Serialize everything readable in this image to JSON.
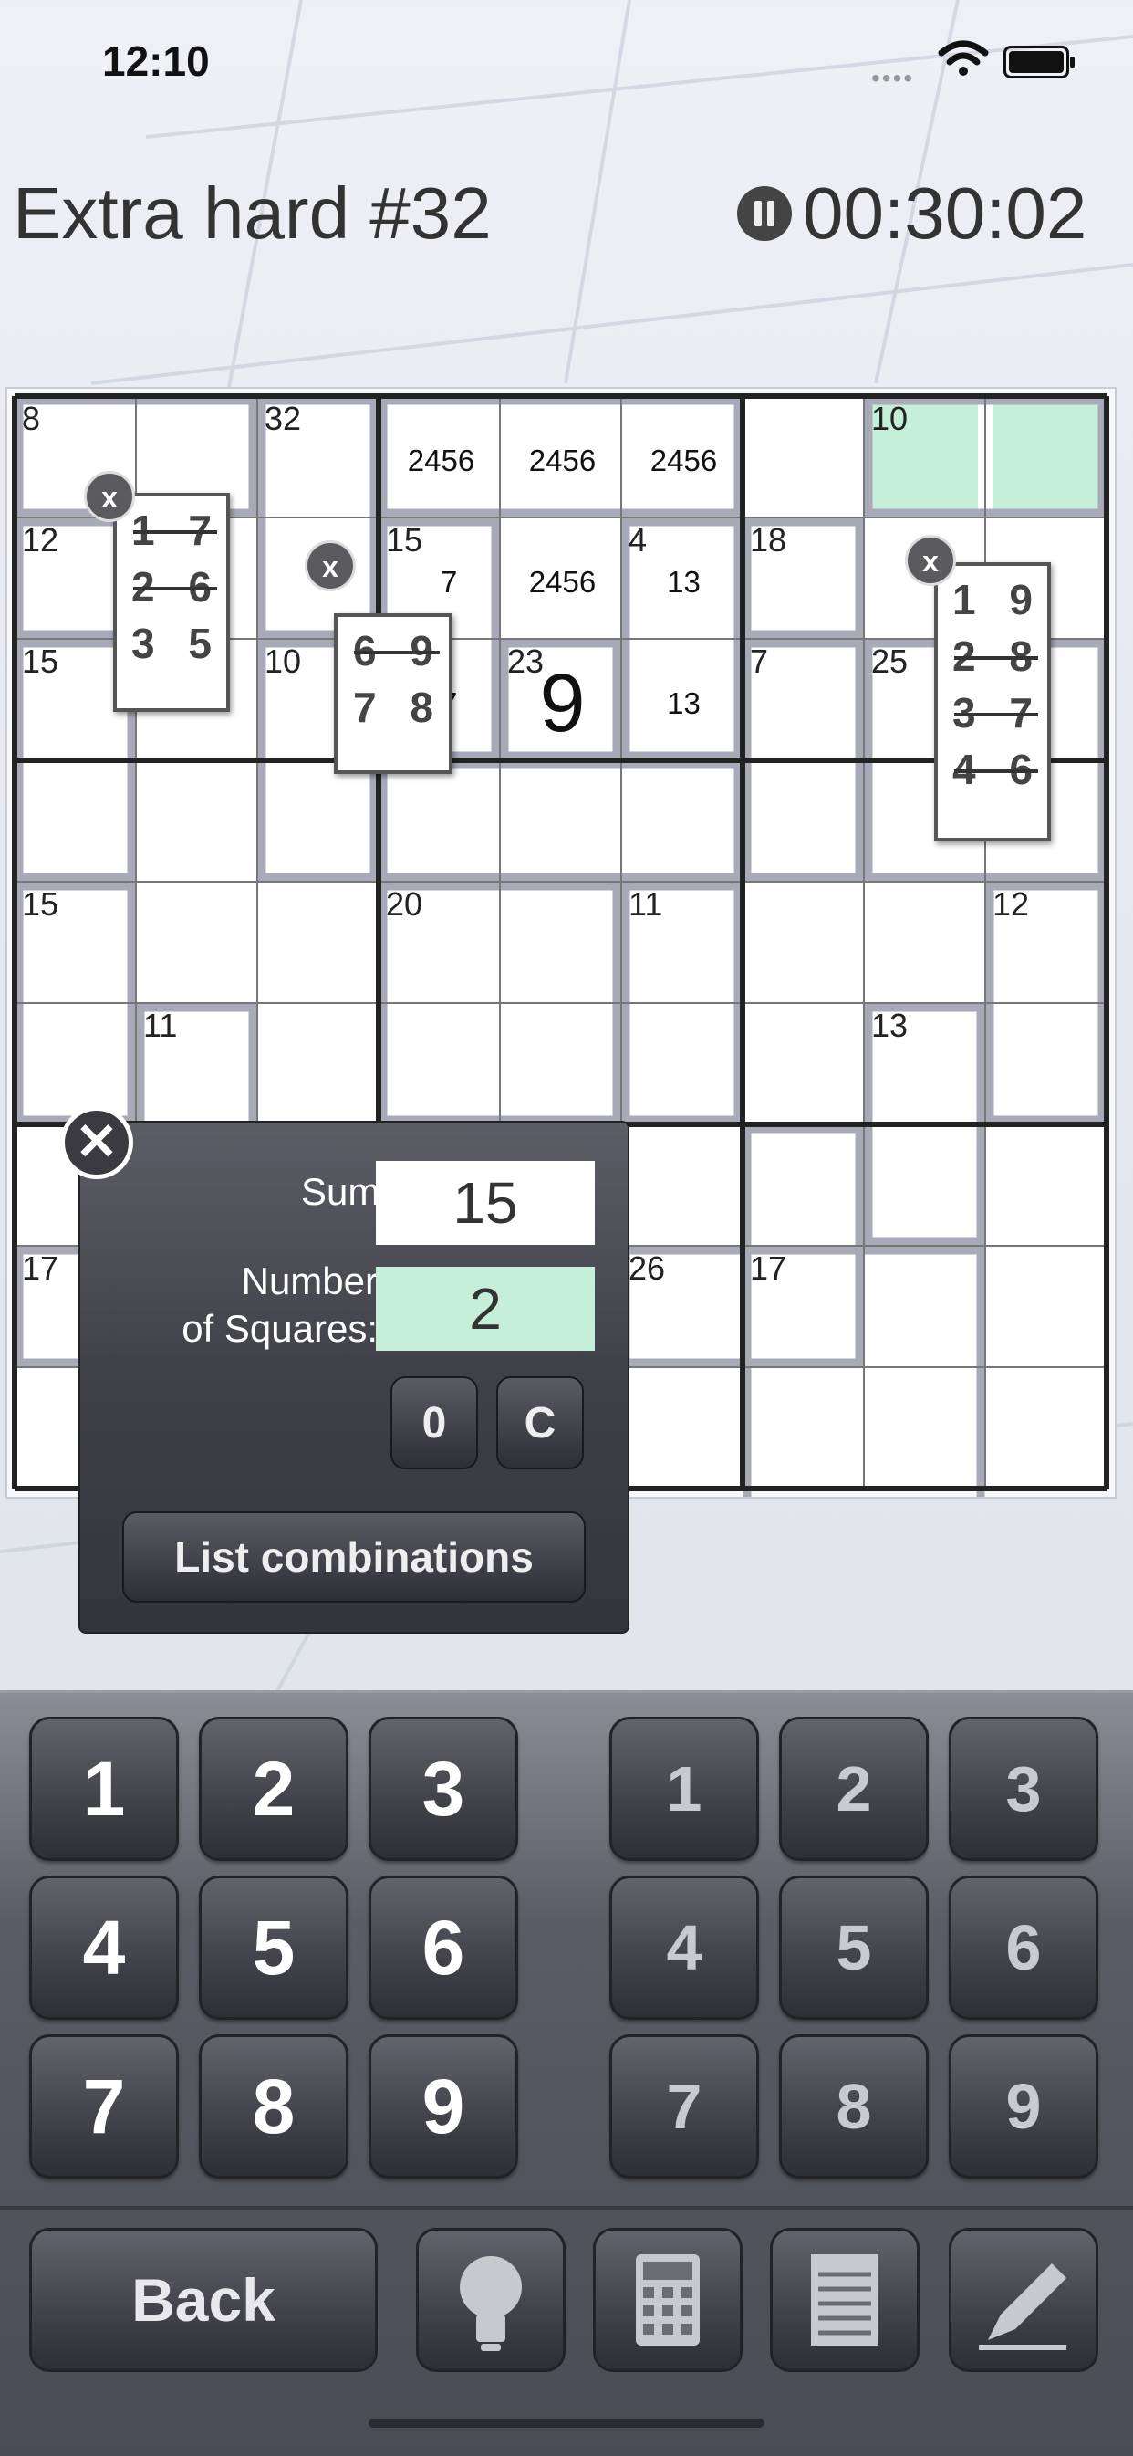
{
  "status": {
    "time": "12:10"
  },
  "header": {
    "title": "Extra hard #32",
    "timer": "00:30:02"
  },
  "board": {
    "cage_sums": [
      {
        "label": "8",
        "cell": [
          0,
          0
        ]
      },
      {
        "label": "32",
        "cell": [
          0,
          2
        ]
      },
      {
        "label": "10",
        "cell": [
          0,
          7
        ]
      },
      {
        "label": "12",
        "cell": [
          1,
          0
        ]
      },
      {
        "label": "15",
        "cell": [
          1,
          3
        ]
      },
      {
        "label": "4",
        "cell": [
          1,
          5
        ]
      },
      {
        "label": "18",
        "cell": [
          1,
          6
        ]
      },
      {
        "label": "15",
        "cell": [
          2,
          0
        ]
      },
      {
        "label": "10",
        "cell": [
          2,
          2
        ]
      },
      {
        "label": "23",
        "cell": [
          2,
          4
        ]
      },
      {
        "label": "7",
        "cell": [
          2,
          6
        ]
      },
      {
        "label": "25",
        "cell": [
          2,
          7
        ]
      },
      {
        "label": "15",
        "cell": [
          4,
          0
        ]
      },
      {
        "label": "20",
        "cell": [
          4,
          3
        ]
      },
      {
        "label": "11",
        "cell": [
          4,
          5
        ]
      },
      {
        "label": "12",
        "cell": [
          4,
          8
        ]
      },
      {
        "label": "11",
        "cell": [
          5,
          1
        ]
      },
      {
        "label": "13",
        "cell": [
          5,
          7
        ]
      },
      {
        "label": "17",
        "cell": [
          7,
          0
        ]
      },
      {
        "label": "26",
        "cell": [
          7,
          5
        ]
      },
      {
        "label": "17",
        "cell": [
          7,
          6
        ]
      }
    ],
    "candidates": [
      {
        "text": "2456",
        "cell": [
          0,
          3
        ]
      },
      {
        "text": "2456",
        "cell": [
          0,
          4
        ]
      },
      {
        "text": "2456",
        "cell": [
          0,
          5
        ]
      },
      {
        "text": "2456",
        "cell": [
          1,
          4
        ]
      },
      {
        "text": "13",
        "cell": [
          1,
          5
        ]
      },
      {
        "text": "13",
        "cell": [
          2,
          5
        ]
      }
    ],
    "values": [
      {
        "text": "9",
        "cell": [
          2,
          4
        ]
      }
    ],
    "highlight_color": "#c6efd9",
    "combo_popups": [
      {
        "rows": [
          {
            "t": "1 7",
            "struck": true
          },
          {
            "t": "2 6",
            "struck": true
          },
          {
            "t": "3 5",
            "struck": false
          }
        ]
      },
      {
        "rows": [
          {
            "t": "6 9",
            "struck": true
          },
          {
            "t": "7 8",
            "struck": false
          }
        ]
      },
      {
        "rows": [
          {
            "t": "1 9",
            "struck": false
          },
          {
            "t": "2 8",
            "struck": true
          },
          {
            "t": "3 7",
            "struck": true
          },
          {
            "t": "4 6",
            "struck": true
          }
        ]
      }
    ],
    "popup_close": "x",
    "hidden_partial": "7"
  },
  "calculator": {
    "sum_label": "Sum:",
    "sum_value": "15",
    "count_label_1": "Number",
    "count_label_2": "of Squares:",
    "count_value": "2",
    "zero_btn": "0",
    "clear_btn": "C",
    "list_btn": "List combinations",
    "close": "✕"
  },
  "keypad": {
    "digits": [
      "1",
      "2",
      "3",
      "4",
      "5",
      "6",
      "7",
      "8",
      "9"
    ],
    "pencil_digits": [
      "1",
      "2",
      "3",
      "4",
      "5",
      "6",
      "7",
      "8",
      "9"
    ],
    "back": "Back",
    "tools": [
      "lightbulb-icon",
      "calculator-icon",
      "notepad-icon",
      "pencil-icon"
    ]
  }
}
